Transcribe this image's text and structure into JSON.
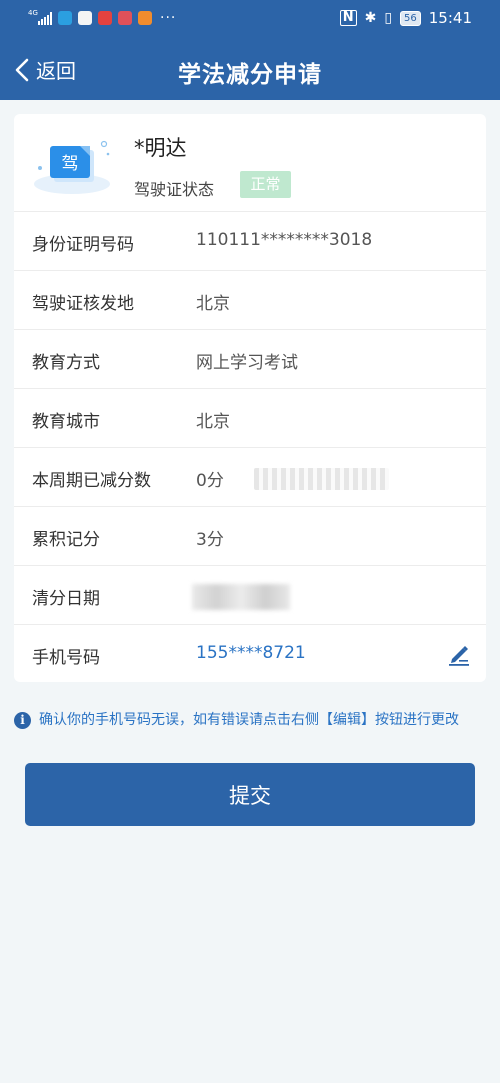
{
  "status_bar": {
    "network": "4G",
    "time": "15:41",
    "battery": "56",
    "more": "···"
  },
  "nav": {
    "back_label": "返回",
    "title": "学法减分申请"
  },
  "profile": {
    "name": "*明达",
    "license_icon_text": "驾",
    "license_status_label": "驾驶证状态",
    "license_status_value": "正常"
  },
  "rows": [
    {
      "label": "身份证明号码",
      "value": "110111********3018"
    },
    {
      "label": "驾驶证核发地",
      "value": "北京"
    },
    {
      "label": "教育方式",
      "value": "网上学习考试"
    },
    {
      "label": "教育城市",
      "value": "北京"
    },
    {
      "label": "本周期已减分数",
      "value": "0分"
    },
    {
      "label": "累积记分",
      "value": "3分"
    },
    {
      "label": "清分日期",
      "value": ""
    },
    {
      "label": "手机号码",
      "value": "155****8721"
    }
  ],
  "notice": {
    "icon": "info-icon",
    "text": "确认你的手机号码无误，如有错误请点击右侧【编辑】按钮进行更改"
  },
  "submit_label": "提交",
  "colors": {
    "primary": "#2c64a8",
    "link": "#2a73c4",
    "status_badge": "#bfe8cf",
    "background": "#f2f6f8"
  }
}
